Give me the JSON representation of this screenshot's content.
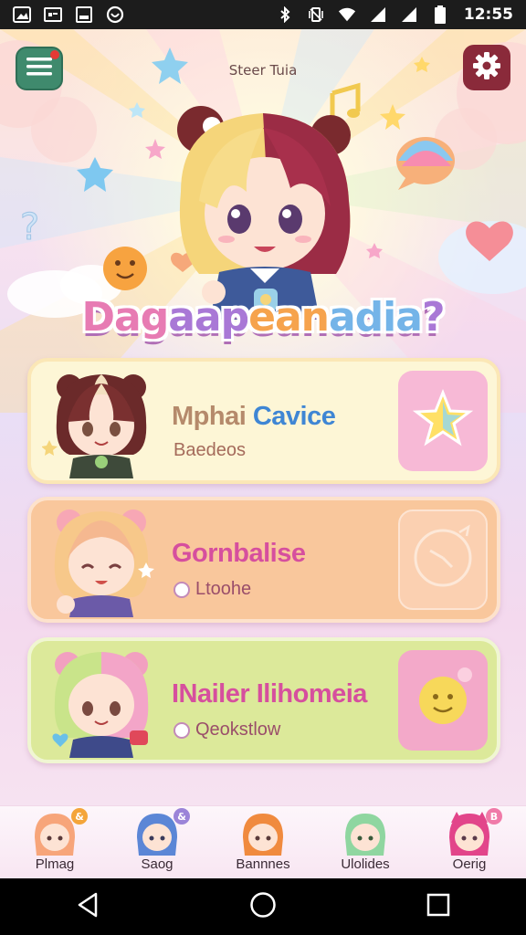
{
  "status_bar": {
    "time": "12:55",
    "left_icons": [
      "gallery-icon",
      "cast-icon",
      "square-icon",
      "whatsapp-icon"
    ],
    "right_icons": [
      "bluetooth-icon",
      "vibrate-icon",
      "wifi-icon",
      "signal-icon",
      "signal-icon",
      "battery-icon"
    ]
  },
  "header": {
    "title": "Steer Tuia",
    "menu_icon": "hamburger-icon",
    "settings_icon": "gear-icon",
    "menu_badge_color": "#e53935"
  },
  "brand": {
    "title_parts": [
      "Dag",
      "aap",
      "ean",
      "adia",
      "?"
    ]
  },
  "cards": [
    {
      "title": "Mphai",
      "title_accent": "Cavice",
      "subtitle": "Baedeos",
      "tile_icon": "star-icon",
      "bg_color": "#fdf6d6"
    },
    {
      "title": "Gornbalise",
      "subtitle": "Ltoohe",
      "tile_icon": "clock-icon",
      "bg_color": "#f9c79c"
    },
    {
      "title": "INailer Ilihomeia",
      "subtitle": "Qeokstlow",
      "tile_icon": "smiley-bubble-icon",
      "bg_color": "#dce99a"
    }
  ],
  "dock": [
    {
      "label": "Plmag",
      "badge": "&",
      "badge_color": "#f4a53a",
      "hair": "#f7a57a"
    },
    {
      "label": "Saog",
      "badge": "&",
      "badge_color": "#9b84d8",
      "hair": "#5b86d6"
    },
    {
      "label": "Bannnes",
      "badge": "",
      "badge_color": "",
      "hair": "#f08a3e"
    },
    {
      "label": "Ulolides",
      "badge": "",
      "badge_color": "",
      "hair": "#8fd6a0"
    },
    {
      "label": "Oerig",
      "badge": "B",
      "badge_color": "#f07aa8",
      "hair": "#e2458a"
    }
  ],
  "nav": {
    "back_icon": "back-triangle-icon",
    "home_icon": "home-circle-icon",
    "recents_icon": "recents-square-icon"
  }
}
